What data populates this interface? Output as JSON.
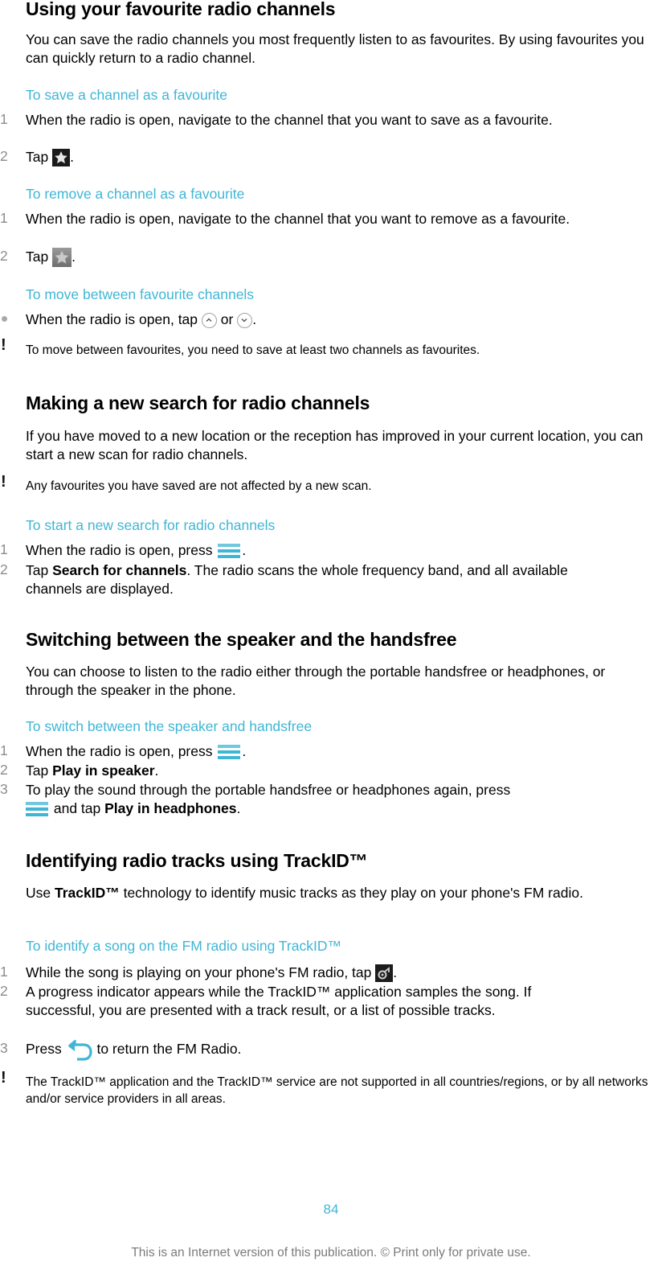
{
  "sections": {
    "favourites": {
      "title": "Using your favourite radio channels",
      "intro": "You can save the radio channels you most frequently listen to as favourites. By using favourites you can quickly return to a radio channel.",
      "save": {
        "heading": "To save a channel as a favourite",
        "steps": [
          {
            "num": "1",
            "text": "When the radio is open, navigate to the channel that you want to save as a favourite."
          },
          {
            "num": "2",
            "pre": "Tap ",
            "icon": "star-filled-icon",
            "post": "."
          }
        ]
      },
      "remove": {
        "heading": "To remove a channel as a favourite",
        "steps": [
          {
            "num": "1",
            "text": "When the radio is open, navigate to the channel that you want to remove as a favourite."
          },
          {
            "num": "2",
            "pre": "Tap ",
            "icon": "star-grey-icon",
            "post": "."
          }
        ]
      },
      "move": {
        "heading": "To move between favourite channels",
        "bullet": {
          "pre": "When the radio is open, tap ",
          "mid": " or ",
          "post": ".",
          "icons": [
            "chevron-up-circle-icon",
            "chevron-down-circle-icon"
          ]
        },
        "note": "To move between favourites, you need to save at least two channels as favourites."
      }
    },
    "search": {
      "title": "Making a new search for radio channels",
      "intro": "If you have moved to a new location or the reception has improved in your current location, you can start a new scan for radio channels.",
      "note": "Any favourites you have saved are not affected by a new scan.",
      "start": {
        "heading": "To start a new search for radio channels",
        "steps": [
          {
            "num": "1",
            "pre": "When the radio is open, press ",
            "icon": "menu-icon",
            "post": "."
          },
          {
            "num": "2",
            "pre": "Tap ",
            "bold": "Search for channels",
            "post": ". The radio scans the whole frequency band, and all available channels are displayed."
          }
        ]
      }
    },
    "speaker": {
      "title": "Switching between the speaker and the handsfree",
      "intro": "You can choose to listen to the radio either through the portable handsfree or headphones, or through the speaker in the phone.",
      "switch": {
        "heading": "To switch between the speaker and handsfree",
        "steps": [
          {
            "num": "1",
            "pre": "When the radio is open, press ",
            "icon": "menu-icon",
            "post": "."
          },
          {
            "num": "2",
            "pre": "Tap ",
            "bold": "Play in speaker",
            "post": "."
          },
          {
            "num": "3",
            "pre": "To play the sound through the portable handsfree or headphones again, press",
            "mid": " and tap ",
            "bold": "Play in headphones",
            "post": "."
          }
        ]
      }
    },
    "trackid": {
      "title": "Identifying radio tracks using TrackID™",
      "intro_pre": "Use ",
      "intro_bold": "TrackID™",
      "intro_post": " technology to identify music tracks as they play on your phone's FM radio.",
      "identify": {
        "heading": "To identify a song on the FM radio using TrackID™",
        "steps": [
          {
            "num": "1",
            "pre": "While the song is playing on your phone's FM radio, tap ",
            "icon": "trackid-icon",
            "post": "."
          },
          {
            "num": "2",
            "text": "A progress indicator appears while the TrackID™ application samples the song. If successful, you are presented with a track result, or a list of possible tracks."
          },
          {
            "num": "3",
            "pre": "Press ",
            "icon": "back-icon",
            "post": " to return the FM Radio."
          }
        ]
      },
      "note": "The TrackID™ application and the TrackID™ service are not supported in all countries/regions, or by all networks and/or service providers in all areas."
    }
  },
  "footer": {
    "page_number": "84",
    "notice": "This is an Internet version of this publication. © Print only for private use."
  },
  "colors": {
    "accent": "#3fb6d5",
    "step_number": "#8c8c8c",
    "footer_text": "#7b7b7b"
  }
}
